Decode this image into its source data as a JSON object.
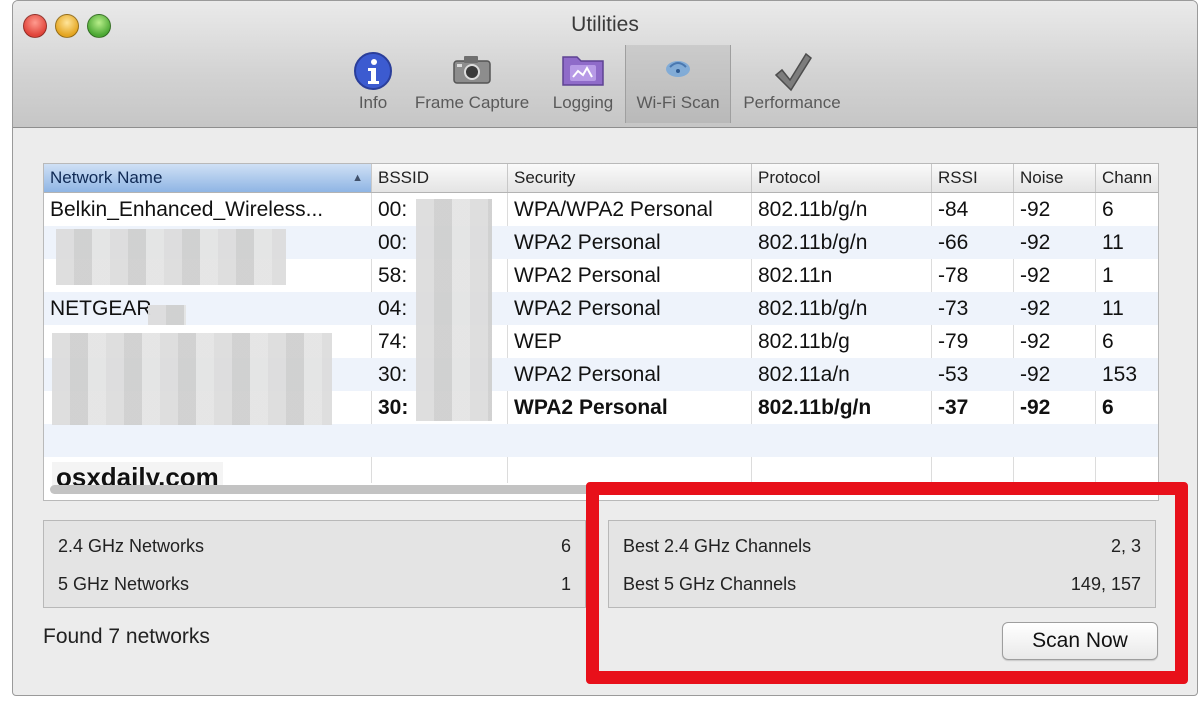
{
  "window": {
    "title": "Utilities"
  },
  "toolbar": {
    "items": [
      {
        "label": "Info"
      },
      {
        "label": "Frame Capture"
      },
      {
        "label": "Logging"
      },
      {
        "label": "Wi-Fi Scan"
      },
      {
        "label": "Performance"
      }
    ]
  },
  "table": {
    "columns": [
      "Network Name",
      "BSSID",
      "Security",
      "Protocol",
      "RSSI",
      "Noise",
      "Chann"
    ],
    "rows": [
      {
        "name": "Belkin_Enhanced_Wireless...",
        "bssid": "00:",
        "security": "WPA/WPA2 Personal",
        "protocol": "802.11b/g/n",
        "rssi": "-84",
        "noise": "-92",
        "channel": "6"
      },
      {
        "name": "",
        "bssid": "00:",
        "security": "WPA2 Personal",
        "protocol": "802.11b/g/n",
        "rssi": "-66",
        "noise": "-92",
        "channel": "11"
      },
      {
        "name": "",
        "bssid": "58:",
        "security": "WPA2 Personal",
        "protocol": "802.11n",
        "rssi": "-78",
        "noise": "-92",
        "channel": "1"
      },
      {
        "name": "NETGEAR",
        "bssid": "04:",
        "security": "WPA2 Personal",
        "protocol": "802.11b/g/n",
        "rssi": "-73",
        "noise": "-92",
        "channel": "11"
      },
      {
        "name": "",
        "bssid": "74:",
        "security": "WEP",
        "protocol": "802.11b/g",
        "rssi": "-79",
        "noise": "-92",
        "channel": "6"
      },
      {
        "name": "",
        "bssid": "30:",
        "security": "WPA2 Personal",
        "protocol": "802.11a/n",
        "rssi": "-53",
        "noise": "-92",
        "channel": "153"
      },
      {
        "name": "",
        "bssid": "30:",
        "security": "WPA2 Personal",
        "protocol": "802.11b/g/n",
        "rssi": "-37",
        "noise": "-92",
        "channel": "6"
      }
    ],
    "watermark": "osxdaily.com"
  },
  "summary_left": {
    "ghz24_label": "2.4 GHz Networks",
    "ghz24_value": "6",
    "ghz5_label": "5 GHz Networks",
    "ghz5_value": "1"
  },
  "summary_right": {
    "best24_label": "Best 2.4 GHz Channels",
    "best24_value": "2, 3",
    "best5_label": "Best 5 GHz Channels",
    "best5_value": "149, 157"
  },
  "status": {
    "found": "Found 7 networks"
  },
  "scan_button": {
    "label": "Scan Now"
  },
  "colors": {
    "highlight": "#e8101a",
    "sorted_header": "#8fb5e4",
    "row_alt": "#eef3fb"
  }
}
